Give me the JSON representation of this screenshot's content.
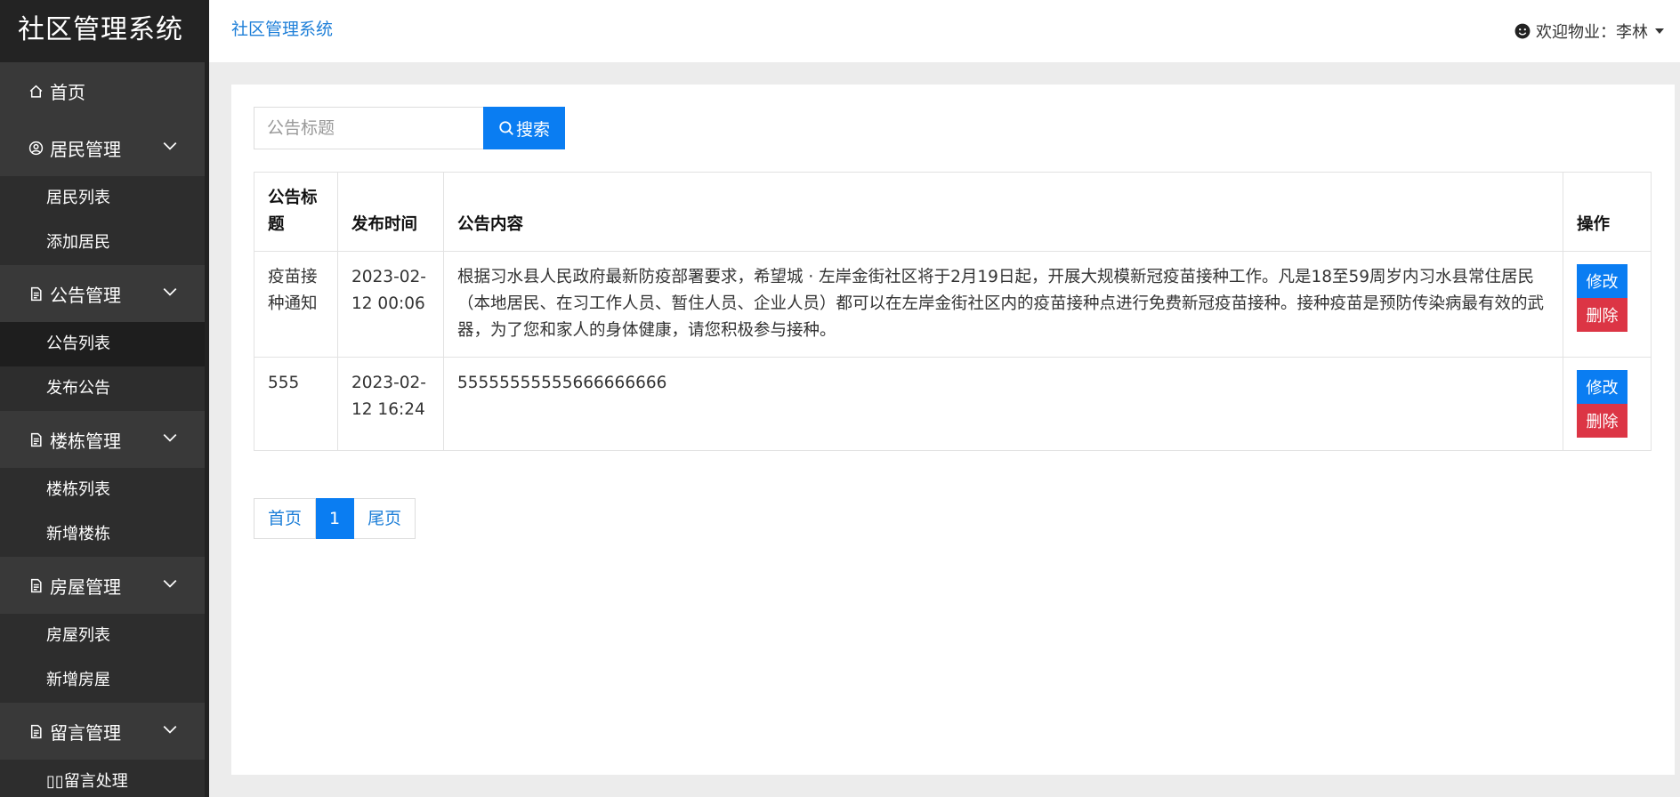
{
  "app": {
    "title": "社区管理系统"
  },
  "header": {
    "brand": "社区管理系统",
    "user_greeting": "欢迎物业：李林"
  },
  "sidebar": {
    "home": "首页",
    "groups": [
      {
        "label": "居民管理",
        "icon": "user-circle-icon",
        "items": [
          "居民列表",
          "添加居民"
        ]
      },
      {
        "label": "公告管理",
        "icon": "document-icon",
        "items": [
          "公告列表",
          "发布公告"
        ],
        "active_item": "公告列表"
      },
      {
        "label": "楼栋管理",
        "icon": "document-icon",
        "items": [
          "楼栋列表",
          "新增楼栋"
        ]
      },
      {
        "label": "房屋管理",
        "icon": "document-icon",
        "items": [
          "房屋列表",
          "新增房屋"
        ]
      },
      {
        "label": "留言管理",
        "icon": "document-icon",
        "items": [
          "▯▯留言处理"
        ]
      }
    ]
  },
  "search": {
    "placeholder": "公告标题",
    "button": "搜索"
  },
  "table": {
    "headers": [
      "公告标题",
      "发布时间",
      "公告内容",
      "操作"
    ],
    "rows": [
      {
        "title": "疫苗接种通知",
        "time": "2023-02-12 00:06",
        "content": "根据习水县人民政府最新防疫部署要求，希望城 · 左岸金街社区将于2月19日起，开展大规模新冠疫苗接种工作。凡是18至59周岁内习水县常住居民（本地居民、在习工作人员、暂住人员、企业人员）都可以在左岸金街社区内的疫苗接种点进行免费新冠疫苗接种。接种疫苗是预防传染病最有效的武器，为了您和家人的身体健康，请您积极参与接种。",
        "edit": "修改",
        "delete": "删除"
      },
      {
        "title": "555",
        "time": "2023-02-12 16:24",
        "content": "55555555555666666666",
        "edit": "修改",
        "delete": "删除"
      }
    ]
  },
  "pagination": {
    "first": "首页",
    "current": "1",
    "last": "尾页"
  },
  "colors": {
    "primary": "#0a7df2",
    "danger": "#dc3545",
    "sidebar_bg": "#393939",
    "logo_bg": "#232323"
  }
}
